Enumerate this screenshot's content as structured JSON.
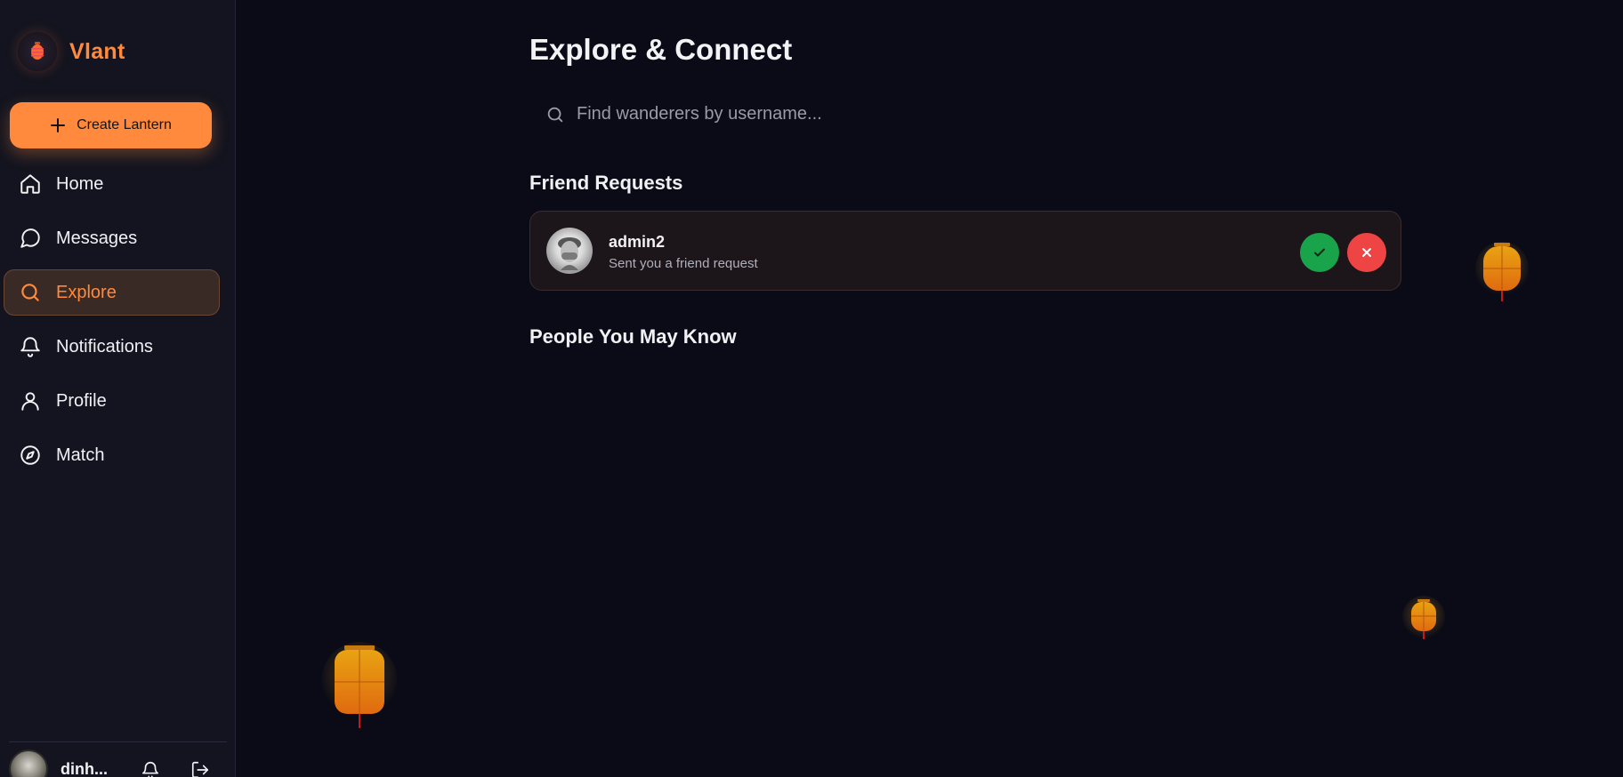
{
  "brand": {
    "name": "Vlant",
    "accent": "#ff8a3d"
  },
  "sidebar": {
    "create_button": "Create Lantern",
    "items": [
      {
        "label": "Home",
        "icon": "home-icon",
        "active": false
      },
      {
        "label": "Messages",
        "icon": "message-icon",
        "active": false
      },
      {
        "label": "Explore",
        "icon": "search-icon",
        "active": true
      },
      {
        "label": "Notifications",
        "icon": "bell-icon",
        "active": false
      },
      {
        "label": "Profile",
        "icon": "user-icon",
        "active": false
      },
      {
        "label": "Match",
        "icon": "compass-icon",
        "active": false
      }
    ],
    "footer": {
      "username": "dinh..."
    }
  },
  "main": {
    "title": "Explore & Connect",
    "search": {
      "placeholder": "Find wanderers by username...",
      "value": ""
    },
    "friend_requests": {
      "title": "Friend Requests",
      "items": [
        {
          "username": "admin2",
          "subtitle": "Sent you a friend request"
        }
      ]
    },
    "people_you_may_know": {
      "title": "People You May Know"
    }
  },
  "colors": {
    "background": "#0a0b17",
    "sidebar": "#13141f",
    "accept": "#19a34a",
    "reject": "#ee4444"
  }
}
